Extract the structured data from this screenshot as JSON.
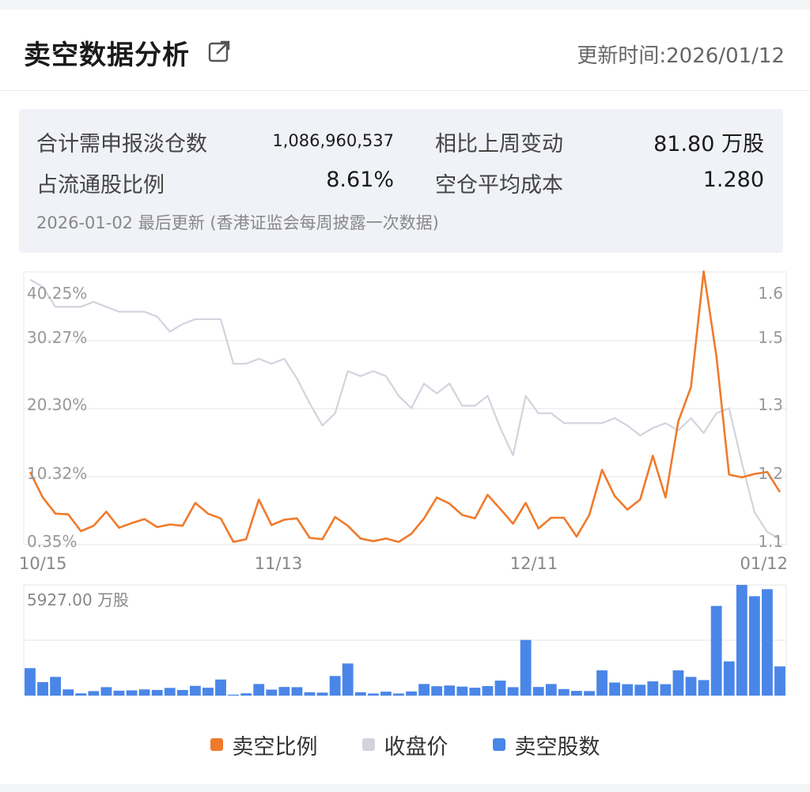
{
  "header": {
    "title": "卖空数据分析",
    "update_time": "更新时间:2026/01/12"
  },
  "stats": {
    "total_label": "合计需申报淡仓数",
    "total_value": "1,086,960,537",
    "change_label": "相比上周变动",
    "change_value": "81.80 万股",
    "ratio_label": "占流通股比例",
    "ratio_value": "8.61%",
    "cost_label": "空仓平均成本",
    "cost_value": "1.280",
    "note": "2026-01-02 最后更新 (香港证监会每周披露一次数据)"
  },
  "chart_data": {
    "type": "line",
    "colors": {
      "ratio": "#f07a2b",
      "price": "#d3d3df",
      "volume": "#4a86e8"
    },
    "x_ticks": [
      "10/15",
      "11/13",
      "12/11",
      "01/12"
    ],
    "y_left_ticks": [
      "40.25%",
      "30.27%",
      "20.30%",
      "10.32%",
      "0.35%"
    ],
    "y_right_ticks": [
      "1.6",
      "1.5",
      "1.3",
      "1.2",
      "1.1"
    ],
    "volume_tick": "5927.00 万股",
    "grid": true,
    "legend_position": "bottom",
    "series": [
      {
        "name": "卖空比例",
        "axis": "left",
        "values": [
          10.8,
          7.0,
          4.6,
          4.5,
          2.0,
          2.8,
          4.9,
          2.5,
          3.2,
          3.8,
          2.6,
          3.0,
          2.8,
          6.2,
          4.6,
          3.9,
          0.4,
          0.8,
          6.7,
          2.9,
          3.7,
          3.9,
          1.0,
          0.8,
          4.1,
          2.8,
          0.9,
          0.5,
          0.9,
          0.4,
          1.6,
          3.9,
          7.0,
          6.1,
          4.4,
          3.9,
          7.4,
          5.3,
          3.1,
          6.2,
          2.4,
          4.0,
          4.0,
          1.2,
          4.4,
          11.1,
          7.2,
          5.2,
          6.7,
          13.2,
          7.0,
          18.3,
          23.4,
          40.6,
          28.0,
          10.4,
          10.0,
          10.5,
          10.8,
          7.8
        ]
      },
      {
        "name": "收盘价",
        "axis": "right",
        "values": [
          1.61,
          1.595,
          1.555,
          1.555,
          1.555,
          1.565,
          1.555,
          1.545,
          1.545,
          1.545,
          1.535,
          1.505,
          1.52,
          1.53,
          1.53,
          1.53,
          1.44,
          1.44,
          1.45,
          1.44,
          1.45,
          1.41,
          1.36,
          1.315,
          1.34,
          1.425,
          1.415,
          1.425,
          1.415,
          1.375,
          1.35,
          1.4,
          1.38,
          1.4,
          1.355,
          1.355,
          1.375,
          1.31,
          1.255,
          1.375,
          1.34,
          1.34,
          1.32,
          1.32,
          1.32,
          1.32,
          1.33,
          1.315,
          1.295,
          1.31,
          1.32,
          1.305,
          1.33,
          1.3,
          1.34,
          1.35,
          1.24,
          1.14,
          1.1,
          1.085
        ]
      }
    ],
    "volume": {
      "name": "卖空股数",
      "unit": "万股",
      "max": 5927.0,
      "values": [
        1470,
        720,
        1000,
        330,
        120,
        240,
        450,
        260,
        280,
        330,
        300,
        410,
        300,
        520,
        420,
        860,
        50,
        120,
        620,
        320,
        460,
        450,
        180,
        160,
        1050,
        1720,
        180,
        110,
        210,
        110,
        220,
        620,
        500,
        540,
        480,
        420,
        510,
        800,
        450,
        2980,
        460,
        620,
        350,
        250,
        240,
        1350,
        700,
        610,
        580,
        760,
        610,
        1350,
        1000,
        830,
        4800,
        1830,
        5927,
        5320,
        5700,
        1560
      ]
    }
  },
  "legend": {
    "ratio_label": "卖空比例",
    "price_label": "收盘价",
    "volume_label": "卖空股数"
  }
}
